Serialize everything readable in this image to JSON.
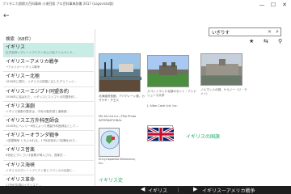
{
  "window": {
    "title": "ブリタニカ国際大百科事典 小項目版 プロ百科事典辞書 2017 (Logovista版)",
    "minimize": "—",
    "maximize": "☐",
    "close": "✕"
  },
  "toolbar": {
    "back": "←",
    "search_value": "いぎりす",
    "clear": "✕",
    "go": "⌕",
    "star": "★",
    "bookmark": "⇆",
    "settings": "⚲"
  },
  "results": {
    "heading": "検索（68件）",
    "items": [
      {
        "title": "イギリス",
        "desc": "正式名称＝グレートブリテンおよび北アイルランド..."
      },
      {
        "title": "イギリスーアメリカ戦争",
        "desc": "→アメリカーイギリス戦争"
      },
      {
        "title": "イギリスー北極",
        "desc": "1858年に発行、イギリスの探検に出したグリニッジ..."
      },
      {
        "title": "イギリスーエジプト同盟条約",
        "desc": "1936年に結ばれた、イギリスとエジプトの同盟条約..."
      },
      {
        "title": "イギリス演劇",
        "desc": "イギリス演劇の歴史は、中世の聖史劇と道徳劇..."
      },
      {
        "title": "イギリスエ方外科医師会",
        "desc": "1540年にヘンリー8世によって理髪外科医師会として..."
      },
      {
        "title": "イギリスーオランダ戦争",
        "desc": "→英蘭戦争 ともいわれる。17世紀後半に3回戦われた..."
      },
      {
        "title": "イギリス音楽",
        "desc": "6世紀にグレゴリオ聖歌が導入され、音楽史..."
      },
      {
        "title": "イギリス海峡",
        "desc": "イギリスのグレートブリテン島とフランスの北部に..."
      },
      {
        "title": "イギリス革命",
        "desc": "17世紀中頃のイギリスで..."
      }
    ]
  },
  "content": {
    "captions": [
      "北海道府首都、アバディーン港。カササギ・チ王ス",
      "スコットランド北部のセント・アンドリューズ大学",
      "ノルマン人の城、ケルノー（ジ・ライト）"
    ],
    "credits": [
      "J. Allan Cash Ltd. Inc.",
      "MS AS Ltd Inc / FRA Photo INTERNATIONAL",
      "Encyclopædia Britannica, Inc."
    ],
    "flag_label": "イギリスの国旗",
    "section_label": "イギリス史"
  },
  "bottom": {
    "prev_arrow": "◀",
    "prev_label": "イギリス",
    "next_label": "イギリスーアメリカ戦争",
    "next_arrow": "▶"
  }
}
